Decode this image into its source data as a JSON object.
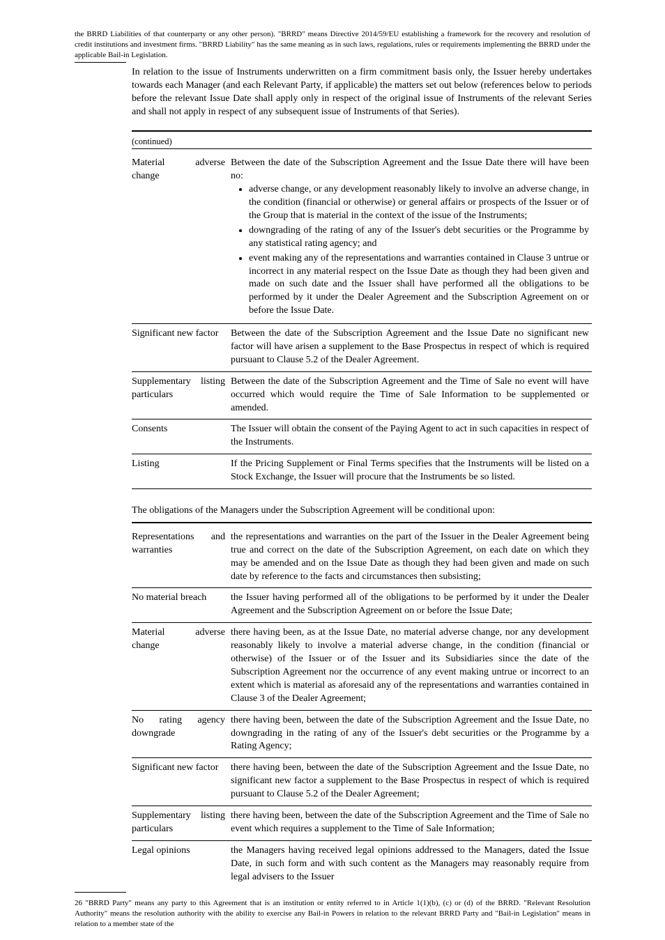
{
  "fn_top": "the BRRD Liabilities of that counterparty or any other person). \"BRRD\" means Directive 2014/59/EU establishing a framework for the recovery and resolution of credit institutions and investment firms. \"BRRD Liability\" has the same meaning as in such laws, regulations, rules or requirements implementing the BRRD under the applicable Bail-in Legislation.",
  "fn_bot": "26 \"BRRD Party\" means any party to this Agreement that is an institution or entity referred to in Article 1(1)(b), (c) or (d) of the BRRD. \"Relevant Resolution Authority\" means the resolution authority with the ability to exercise any Bail-in Powers in relation to the relevant BRRD Party and \"Bail-in Legislation\" means in relation to a member state of the",
  "intro": "In relation to the issue of Instruments underwritten on a firm commitment basis only, the Issuer hereby undertakes towards each Manager (and each Relevant Party, if applicable) the matters set out below (references below to periods before the relevant Issue Date shall apply only in respect of the original issue of Instruments of the relevant Series and shall not apply in respect of any subsequent issue of Instruments of that Series).",
  "table1": {
    "continued": "(continued)",
    "rows": [
      {
        "label": "Material adverse change",
        "bullets": [
          "Between the date of the Subscription Agreement and the Issue Date there will have been no:",
          "adverse change, or any development reasonably likely to involve an adverse change, in the condition (financial or otherwise) or general affairs or prospects of the Issuer or of the Group that is material in the context of the issue of the Instruments;",
          "downgrading of the rating of any of the Issuer's debt securities or the Programme by any statistical rating agency; and",
          "event making any of the representations and warranties contained in Clause 3 untrue or incorrect in any material respect on the Issue Date as though they had been given and made on such date and the Issuer shall have performed all the obligations to be performed by it under the Dealer Agreement and the Subscription Agreement on or before the Issue Date."
        ]
      },
      {
        "label": "Significant new factor",
        "body": "Between the date of the Subscription Agreement and the Issue Date no significant new factor will have arisen a supplement to the Base Prospectus in respect of which is required pursuant to Clause 5.2 of the Dealer Agreement."
      },
      {
        "label": "Supplementary listing particulars",
        "body": "Between the date of the Subscription Agreement and the Time of Sale no event will have occurred which would require the Time of Sale Information to be supplemented or amended."
      },
      {
        "label": "Consents",
        "body": "The Issuer will obtain the consent of the Paying Agent to act in such capacities in respect of the Instruments."
      },
      {
        "label": "Listing",
        "body": "If the Pricing Supplement or Final Terms specifies that the Instruments will be listed on a Stock Exchange, the Issuer will procure that the Instruments be so listed."
      }
    ]
  },
  "table2_title": "The obligations of the Managers under the Subscription Agreement will be conditional upon:",
  "table2": {
    "rows": [
      {
        "label": "Representations and warranties",
        "body": "the representations and warranties on the part of the Issuer in the Dealer Agreement being true and correct on the date of the Subscription Agreement, on each date on which they may be amended and on the Issue Date as though they had been given and made on such date by reference to the facts and circumstances then subsisting;"
      },
      {
        "label": "No material breach",
        "body": "the Issuer having performed all of the obligations to be performed by it under the Dealer Agreement and the Subscription Agreement on or before the Issue Date;"
      },
      {
        "label": "Material adverse change",
        "body": "there having been, as at the Issue Date, no material adverse change, nor any development reasonably likely to involve a material adverse change, in the condition (financial or otherwise) of the Issuer or of the Issuer and its Subsidiaries since the date of the Subscription Agreement nor the occurrence of any event making untrue or incorrect to an extent which is material as aforesaid any of the representations and warranties contained in Clause 3 of the Dealer Agreement;"
      },
      {
        "label": "No rating agency downgrade",
        "body": "there having been, between the date of the Subscription Agreement and the Issue Date, no downgrading in the rating of any of the Issuer's debt securities or the Programme by a Rating Agency;"
      },
      {
        "label": "Significant new factor",
        "body": "there having been, between the date of the Subscription Agreement and the Issue Date, no significant new factor a supplement to the Base Prospectus in respect of which is required pursuant to Clause 5.2 of the Dealer Agreement;"
      },
      {
        "label": "Supplementary listing particulars",
        "body": "there having been, between the date of the Subscription Agreement and the Time of Sale no event which requires a supplement to the Time of Sale Information;"
      },
      {
        "label": "Legal opinions",
        "body": "the Managers having received legal opinions addressed to the Managers, dated the Issue Date, in such form and with such content as the Managers may reasonably require from legal advisers to the Issuer"
      }
    ]
  }
}
